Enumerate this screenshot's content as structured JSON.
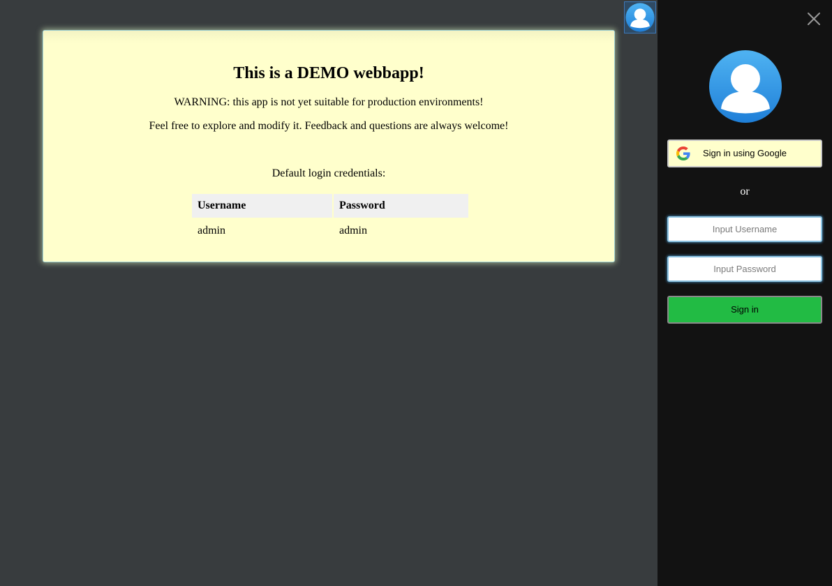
{
  "demo_notice": {
    "title": "This is a DEMO webbapp!",
    "warning": "WARNING: this app is not yet suitable for production environments!",
    "feedback": "Feel free to explore and modify it. Feedback and questions are always welcome!",
    "credentials_label": "Default login credentials:",
    "table": {
      "headers": [
        "Username",
        "Password"
      ],
      "rows": [
        [
          "admin",
          "admin"
        ]
      ]
    }
  },
  "header": {
    "avatar_icon": "user-avatar-icon"
  },
  "login_panel": {
    "close_icon": "close-icon",
    "avatar_icon": "user-avatar-icon",
    "google_button": {
      "label": "Sign in using Google",
      "icon": "google-g-icon"
    },
    "separator": "or",
    "username": {
      "placeholder": "Input Username",
      "value": ""
    },
    "password": {
      "placeholder": "Input Password",
      "value": ""
    },
    "signin_label": "Sign in"
  },
  "colors": {
    "background": "#383c3e",
    "card_background": "#ffffcc",
    "panel_background": "#121212",
    "avatar_blue": "#2f9ae6",
    "signin_green": "#22bb44"
  }
}
